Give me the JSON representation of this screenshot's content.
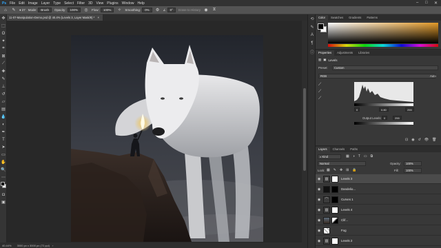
{
  "menubar": {
    "app_icon": "photoshop-icon",
    "items": [
      "File",
      "Edit",
      "Image",
      "Layer",
      "Type",
      "Select",
      "Filter",
      "3D",
      "View",
      "Plugins",
      "Window",
      "Help"
    ],
    "window_controls": [
      "minimize-icon",
      "maximize-icon",
      "close-icon"
    ]
  },
  "options": {
    "home_icon": "home-icon",
    "brush_icon": "brush-icon",
    "brush_size": "27",
    "mode_label": "Mode:",
    "mode_value": "Brush",
    "opacity_label": "Opacity:",
    "opacity_value": "100%",
    "flow_label": "Flow:",
    "flow_value": "100%",
    "smoothing_label": "Smoothing:",
    "smoothing_value": "0%",
    "angle_value": "0°",
    "erase_label": "Erase to History"
  },
  "document": {
    "tab_title": "11-07-Manipulation-Demo.psd @ 40.4% (Levels 3, Layer Mask/8) *",
    "status_zoom": "40.44%",
    "status_size": "3000 px x 3000 px (72 ppi)"
  },
  "panels": {
    "color_tabs": [
      "Color",
      "Swatches",
      "Gradients",
      "Patterns"
    ],
    "properties_tabs": [
      "Properties",
      "Adjustments",
      "Libraries"
    ],
    "properties_title": "Levels",
    "preset_label": "Preset:",
    "preset_value": "Custom",
    "channel_value": "RGB",
    "auto_label": "Auto",
    "input_black": "0",
    "input_gamma": "0.80",
    "input_white": "255",
    "output_label": "Output Levels:",
    "output_black": "0",
    "output_white": "255",
    "layers_tabs": [
      "Layers",
      "Channels",
      "Paths"
    ],
    "filter_kind": "Kind",
    "blend_mode": "Normal",
    "opacity_label": "Opacity:",
    "opacity_value": "100%",
    "lock_label": "Lock:",
    "fill_label": "Fill:",
    "fill_value": "100%",
    "layers": [
      {
        "name": "Levels 3",
        "thumb": "levels-icon",
        "selected": true
      },
      {
        "name": "Dandelio...",
        "thumb": "photo",
        "selected": false
      },
      {
        "name": "Curves 1",
        "thumb": "curves-icon",
        "selected": false
      },
      {
        "name": "Levels 4",
        "thumb": "levels-icon",
        "selected": false
      },
      {
        "name": "Clif...",
        "thumb": "photo",
        "selected": false
      },
      {
        "name": "Fog",
        "thumb": "photo",
        "selected": false
      },
      {
        "name": "Levels 2",
        "thumb": "levels-icon",
        "selected": false
      }
    ]
  },
  "colors": {
    "menubar_bg": "#323232",
    "options_bg": "#535353",
    "panel_bg": "#383838",
    "canvas_bg": "#282828",
    "accent_orange": "#e39a28"
  }
}
